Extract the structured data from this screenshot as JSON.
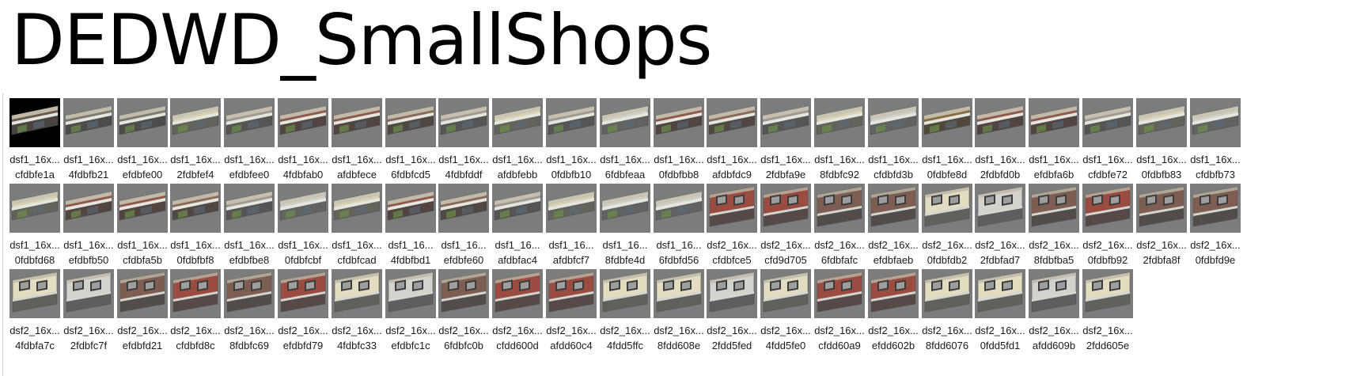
{
  "title": "DEDWD_SmallShops",
  "tiles": [
    {
      "name": "dsf1_16x...",
      "hash": "cfdbfe1a",
      "style": "dark",
      "selected": true
    },
    {
      "name": "dsf1_16x...",
      "hash": "4fdbfb21",
      "style": "green"
    },
    {
      "name": "dsf1_16x...",
      "hash": "efdbfe00",
      "style": "green"
    },
    {
      "name": "dsf1_16x...",
      "hash": "2fdbfef4",
      "style": "cream"
    },
    {
      "name": "dsf1_16x...",
      "hash": "efdbfee0",
      "style": "grey"
    },
    {
      "name": "dsf1_16x...",
      "hash": "4fdbfab0",
      "style": "red"
    },
    {
      "name": "dsf1_16x...",
      "hash": "afdbfece",
      "style": "red"
    },
    {
      "name": "dsf1_16x...",
      "hash": "6fdbfcd5",
      "style": "brick"
    },
    {
      "name": "dsf1_16x...",
      "hash": "4fdbfddf",
      "style": "grey"
    },
    {
      "name": "dsf1_16x...",
      "hash": "afdbfebb",
      "style": "cream"
    },
    {
      "name": "dsf1_16x...",
      "hash": "0fdbfb10",
      "style": "grey"
    },
    {
      "name": "dsf1_16x...",
      "hash": "6fdbfeaa",
      "style": "white"
    },
    {
      "name": "dsf1_16x...",
      "hash": "0fdbfbb8",
      "style": "red"
    },
    {
      "name": "dsf1_16x...",
      "hash": "afdbfdc9",
      "style": "brick"
    },
    {
      "name": "dsf1_16x...",
      "hash": "2fdbfa9e",
      "style": "grey"
    },
    {
      "name": "dsf1_16x...",
      "hash": "8fdbfc92",
      "style": "cream"
    },
    {
      "name": "dsf1_16x...",
      "hash": "cfdbfd3b",
      "style": "white"
    },
    {
      "name": "dsf1_16x...",
      "hash": "0fdbfe8d",
      "style": "brown"
    },
    {
      "name": "dsf1_16x...",
      "hash": "2fdbfd0b",
      "style": "red"
    },
    {
      "name": "dsf1_16x...",
      "hash": "efdbfa6b",
      "style": "red"
    },
    {
      "name": "dsf1_16x...",
      "hash": "cfdbfe72",
      "style": "grey"
    },
    {
      "name": "dsf1_16x...",
      "hash": "0fdbfb83",
      "style": "cream"
    },
    {
      "name": "dsf1_16x...",
      "hash": "cfdbfb73",
      "style": "white"
    },
    {
      "name": "dsf1_16x...",
      "hash": "0fdbfd68",
      "style": "cream"
    },
    {
      "name": "dsf1_16x...",
      "hash": "efdbfb50",
      "style": "red"
    },
    {
      "name": "dsf1_16x...",
      "hash": "cfdbfa5b",
      "style": "red"
    },
    {
      "name": "dsf1_16x...",
      "hash": "0fdbfbf8",
      "style": "brick"
    },
    {
      "name": "dsf1_16x...",
      "hash": "efdbfbe8",
      "style": "grey"
    },
    {
      "name": "dsf1_16x...",
      "hash": "0fdbfcbf",
      "style": "white"
    },
    {
      "name": "dsf1_16x...",
      "hash": "cfdbfcad",
      "style": "cream"
    },
    {
      "name": "dsf1_16...",
      "hash": "4fdbfbd1",
      "style": "red"
    },
    {
      "name": "dsf1_16...",
      "hash": "efdbfe60",
      "style": "brick"
    },
    {
      "name": "dsf1_16...",
      "hash": "afdbfac4",
      "style": "grey"
    },
    {
      "name": "dsf1_16...",
      "hash": "afdbfcf7",
      "style": "cream"
    },
    {
      "name": "dsf1_16...",
      "hash": "8fdbfe4d",
      "style": "white"
    },
    {
      "name": "dsf1_16...",
      "hash": "6fdbfd56",
      "style": "white"
    },
    {
      "name": "dsf2_16x...",
      "hash": "cfdbfce5",
      "style": "red2"
    },
    {
      "name": "dsf2_16x...",
      "hash": "cfd9d705",
      "style": "red2"
    },
    {
      "name": "dsf2_16x...",
      "hash": "6fdbfafc",
      "style": "brick2"
    },
    {
      "name": "dsf2_16x...",
      "hash": "efdbfaeb",
      "style": "brick2"
    },
    {
      "name": "dsf2_16x...",
      "hash": "0fdbfdb2",
      "style": "cream2"
    },
    {
      "name": "dsf2_16x...",
      "hash": "2fdbfad7",
      "style": "white2"
    },
    {
      "name": "dsf2_16x...",
      "hash": "8fdbfba5",
      "style": "brick2"
    },
    {
      "name": "dsf2_16x...",
      "hash": "0fdbfb92",
      "style": "red2"
    },
    {
      "name": "dsf2_16x...",
      "hash": "2fdbfa8f",
      "style": "brick2"
    },
    {
      "name": "dsf2_16x...",
      "hash": "0fdbfd9e",
      "style": "brick2"
    },
    {
      "name": "dsf2_16x...",
      "hash": "4fdbfa7c",
      "style": "cream2"
    },
    {
      "name": "dsf2_16x...",
      "hash": "2fdbfc7f",
      "style": "white2"
    },
    {
      "name": "dsf2_16x...",
      "hash": "efdbfd21",
      "style": "brick2"
    },
    {
      "name": "dsf2_16x...",
      "hash": "cfdbfd8c",
      "style": "red2"
    },
    {
      "name": "dsf2_16x...",
      "hash": "8fdbfc69",
      "style": "brick2"
    },
    {
      "name": "dsf2_16x...",
      "hash": "efdbfd79",
      "style": "red2"
    },
    {
      "name": "dsf2_16x...",
      "hash": "4fdbfc33",
      "style": "cream2"
    },
    {
      "name": "dsf2_16x...",
      "hash": "efdbfc1c",
      "style": "white2"
    },
    {
      "name": "dsf2_16x...",
      "hash": "6fdbfc0b",
      "style": "brick2"
    },
    {
      "name": "dsf2_16x...",
      "hash": "cfdd600d",
      "style": "red2"
    },
    {
      "name": "dsf2_16x...",
      "hash": "afdd60c4",
      "style": "red2"
    },
    {
      "name": "dsf2_16x...",
      "hash": "4fdd5ffc",
      "style": "cream2"
    },
    {
      "name": "dsf2_16x...",
      "hash": "8fdd608e",
      "style": "cream2"
    },
    {
      "name": "dsf2_16x...",
      "hash": "2fdd5fed",
      "style": "white2"
    },
    {
      "name": "dsf2_16x...",
      "hash": "4fdd5fe0",
      "style": "cream2"
    },
    {
      "name": "dsf2_16x...",
      "hash": "cfdd60a9",
      "style": "red2"
    },
    {
      "name": "dsf2_16x...",
      "hash": "efdd602b",
      "style": "red2"
    },
    {
      "name": "dsf2_16x...",
      "hash": "8fdd6076",
      "style": "cream2"
    },
    {
      "name": "dsf2_16x...",
      "hash": "0fdd5fd1",
      "style": "cream2"
    },
    {
      "name": "dsf2_16x...",
      "hash": "afdd609b",
      "style": "white2"
    },
    {
      "name": "dsf2_16x...",
      "hash": "2fdd605e",
      "style": "cream2"
    }
  ],
  "colors": {
    "thumb_bg": "#7c7c7c",
    "selected_bg": "#000000",
    "dark": "#6b5a4e",
    "green": "#7d7a70",
    "cream": "#d8d2b4",
    "grey": "#a09a92",
    "red": "#8f5a4c",
    "brick": "#8a6a58",
    "white": "#cfcfc8",
    "brown": "#8a6e42",
    "red2": "#9a4c40",
    "brick2": "#7e5e52",
    "cream2": "#e2dcc0",
    "white2": "#d4d2cc"
  }
}
